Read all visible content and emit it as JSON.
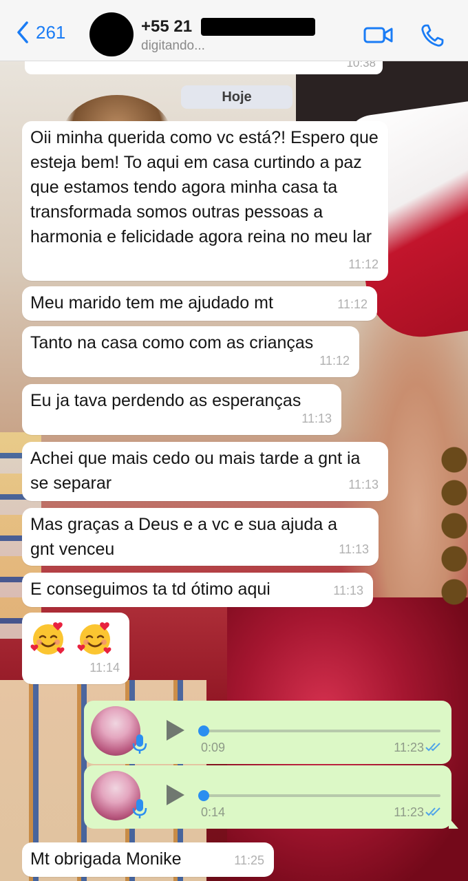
{
  "header": {
    "back_count": "261",
    "contact_name": "+55 21",
    "status": "digitando..."
  },
  "chat": {
    "prev_time": "10:38",
    "date_label": "Hoje",
    "incoming": [
      {
        "text": "Oii minha querida como vc está?! Espero que esteja bem! To aqui em casa curtindo a paz que estamos tendo agora minha casa ta transformada somos outras pessoas a harmonia e felicidade agora reina no meu lar",
        "time": "11:12"
      },
      {
        "text": "Meu marido tem me ajudado mt",
        "time": "11:12"
      },
      {
        "text": "Tanto na casa como com as crianças",
        "time": "11:12"
      },
      {
        "text": "Eu ja tava perdendo as esperanças",
        "time": "11:13"
      },
      {
        "text": "Achei que mais cedo ou mais tarde a gnt ia se separar",
        "time": "11:13"
      },
      {
        "text": "Mas graças a Deus e a vc e sua ajuda a gnt venceu",
        "time": "11:13"
      },
      {
        "text": "E conseguimos ta td ótimo aqui",
        "time": "11:13"
      }
    ],
    "emoji_message": {
      "emojis": [
        "smiling-face-with-hearts",
        "smiling-face-with-hearts"
      ],
      "time": "11:14"
    },
    "voice_notes": [
      {
        "duration": "0:09",
        "time": "11:23",
        "status": "read"
      },
      {
        "duration": "0:14",
        "time": "11:23",
        "status": "read"
      }
    ],
    "last": {
      "text": "Mt obrigada Monike",
      "time": "11:25"
    }
  },
  "colors": {
    "accent": "#1a7cf5",
    "outgoing_bubble": "#dcf8c6",
    "incoming_bubble": "#ffffff"
  }
}
